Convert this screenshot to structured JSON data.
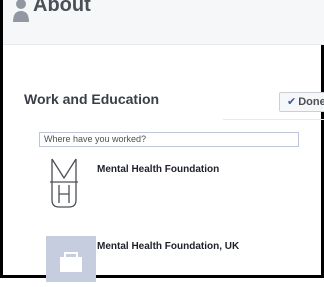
{
  "header": {
    "title": "About",
    "icon": "person-icon"
  },
  "section": {
    "title": "Work and Education",
    "done_label": "Done",
    "done_icon": "checkmark-icon"
  },
  "search": {
    "placeholder": "Where have you worked?",
    "value": ""
  },
  "results": [
    {
      "name": "Mental Health Foundation",
      "icon": "mhf-logo-icon"
    },
    {
      "name": "Mental Health Foundation, UK",
      "icon": "briefcase-icon"
    }
  ],
  "colors": {
    "header_bg": "#f6f7f9",
    "brand_blue": "#3b5998",
    "thumb_bg": "#c6cddf"
  }
}
